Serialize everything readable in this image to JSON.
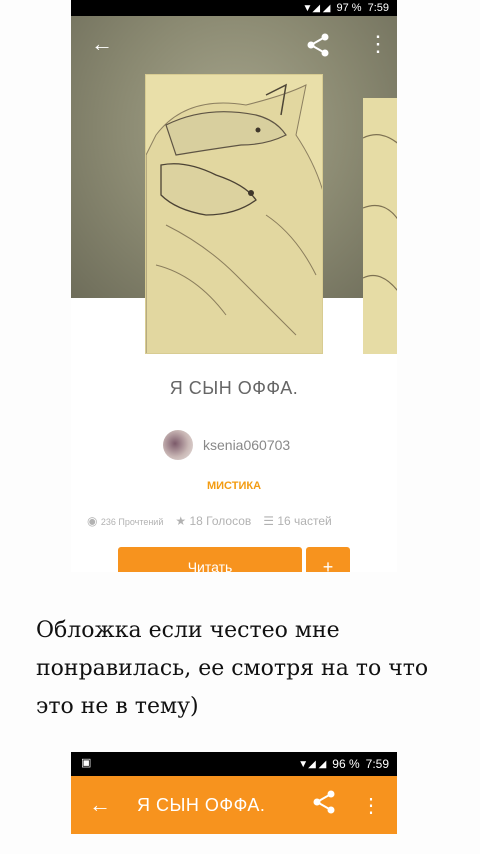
{
  "screenshot1": {
    "status": {
      "signal": "▼◢ ◢",
      "battery": "97 %",
      "time": "7:59"
    },
    "toolbar": {
      "back": "←",
      "share": "<",
      "more": "⋮"
    },
    "book": {
      "title": "Я СЫН ОФФА.",
      "author": "ksenia060703",
      "genre": "МИСТИКА",
      "reads": "236 Прочтений",
      "votes": "18 Голосов",
      "parts": "16 частей"
    },
    "actions": {
      "read": "Читать",
      "add": "+"
    }
  },
  "caption": "Обложка если честео мне понравилась, ее смотря на то что это не в тему)",
  "screenshot2": {
    "status": {
      "gallery": "▣",
      "signal": "▼◢ ◢",
      "battery": "96 %",
      "time": "7:59"
    },
    "toolbar": {
      "back": "←",
      "title": "Я СЫН ОФФА.",
      "share": "<",
      "more": "⋮"
    }
  },
  "colors": {
    "accent": "#f7931e",
    "genre": "#f39c12"
  },
  "icons": [
    "back-icon",
    "share-icon",
    "more-icon",
    "eye-icon",
    "star-icon",
    "list-icon"
  ]
}
